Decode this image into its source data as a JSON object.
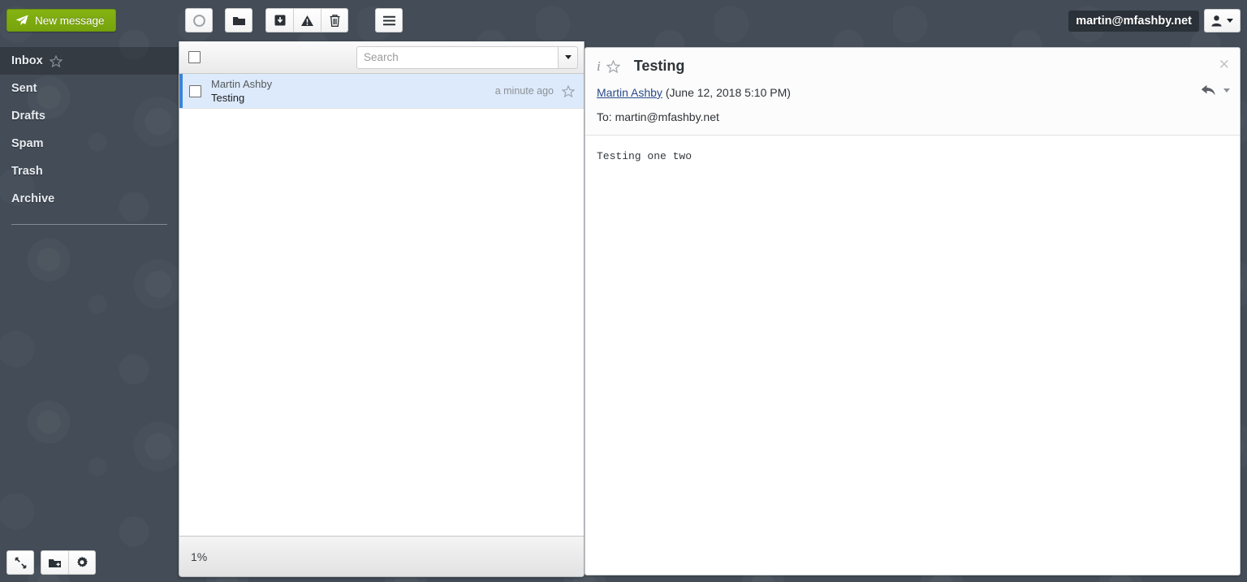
{
  "topbar": {
    "new_message_label": "New message",
    "new_message_icon": "paper-plane-icon",
    "buttons": [
      {
        "name": "refresh-button",
        "icon": "circle-refresh-icon"
      },
      {
        "name": "folder-button",
        "icon": "folder-icon"
      },
      {
        "name": "archive-button",
        "icon": "archive-box-icon"
      },
      {
        "name": "spam-button",
        "icon": "warning-triangle-icon"
      },
      {
        "name": "delete-button",
        "icon": "trash-icon"
      },
      {
        "name": "menu-button",
        "icon": "hamburger-menu-icon"
      }
    ],
    "user_email": "martin@mfashby.net",
    "user_icon": "user-avatar-icon"
  },
  "sidebar": {
    "folders": [
      {
        "label": "Inbox",
        "selected": true,
        "star": true
      },
      {
        "label": "Sent",
        "selected": false,
        "star": false
      },
      {
        "label": "Drafts",
        "selected": false,
        "star": false
      },
      {
        "label": "Spam",
        "selected": false,
        "star": false
      },
      {
        "label": "Trash",
        "selected": false,
        "star": false
      },
      {
        "label": "Archive",
        "selected": false,
        "star": false
      }
    ],
    "bottom_buttons": [
      {
        "name": "collapse-button",
        "icon": "collapse-arrows-icon"
      },
      {
        "name": "add-folder-button",
        "icon": "folder-add-icon"
      },
      {
        "name": "settings-button",
        "icon": "gear-icon"
      }
    ]
  },
  "list": {
    "search_placeholder": "Search",
    "search_value": "",
    "select_all_checked": false,
    "messages": [
      {
        "from": "Martin Ashby",
        "subject": "Testing",
        "time": "a minute ago",
        "selected": true,
        "checked": false,
        "starred": false
      }
    ],
    "status_text": "1%"
  },
  "message": {
    "title": "Testing",
    "sender": "Martin Ashby",
    "date": "(June 12, 2018 5:10 PM)",
    "to_label": "To: martin@mfashby.net",
    "body": "Testing one two"
  },
  "colors": {
    "accent_green": "#7ca80d",
    "selection_blue": "#ddeafb",
    "selection_bar": "#3b83d8",
    "sidebar_bg": "#434c57",
    "link": "#2a4a8a"
  }
}
